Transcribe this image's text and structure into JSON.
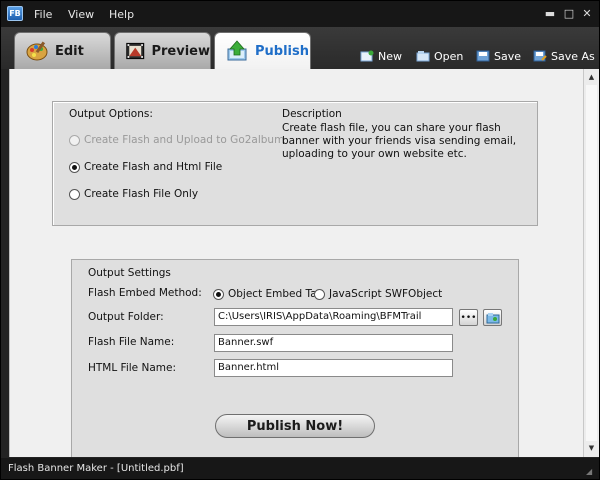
{
  "app": {
    "logo_text": "FB"
  },
  "menubar": {
    "items": [
      "File",
      "View",
      "Help"
    ]
  },
  "window_controls": {
    "minimize": "▬",
    "maximize": "□",
    "close": "✕"
  },
  "tabs": [
    {
      "label": "Edit",
      "icon": "palette-icon",
      "active": false
    },
    {
      "label": "Preview",
      "icon": "film-icon",
      "active": false
    },
    {
      "label": "Publish",
      "icon": "publish-arrow-icon",
      "active": true
    }
  ],
  "toolbar": {
    "new_label": "New",
    "open_label": "Open",
    "save_label": "Save",
    "saveas_label": "Save As"
  },
  "output_options": {
    "title": "Output Options:",
    "description_title": "Description",
    "description_text": "Create flash file, you can share your flash banner with your friends visa sending email, uploading to your own website etc.",
    "choices": [
      {
        "label": "Create Flash and Upload to Go2album",
        "checked": false,
        "disabled": true
      },
      {
        "label": "Create Flash and Html File",
        "checked": true,
        "disabled": false
      },
      {
        "label": "Create Flash File Only",
        "checked": false,
        "disabled": false
      }
    ]
  },
  "output_settings": {
    "title": "Output Settings",
    "embed_label": "Flash Embed Method:",
    "embed_option_1": "Object Embed Tag",
    "embed_option_2": "JavaScript SWFObject",
    "embed_selected": "Object Embed Tag",
    "folder_label": "Output Folder:",
    "folder_value": "C:\\Users\\IRIS\\AppData\\Roaming\\BFMTrail",
    "browse_label": "•••",
    "flash_name_label": "Flash File Name:",
    "flash_name_value": "Banner.swf",
    "html_name_label": "HTML File Name:",
    "html_name_value": "Banner.html",
    "publish_label": "Publish Now!"
  },
  "statusbar": {
    "text": "Flash Banner Maker - [Untitled.pbf]"
  },
  "colors": {
    "chrome": "#171717",
    "content": "#f0f0f0",
    "panel": "#dfdfdf",
    "active_tab_text": "#1f6ec8"
  }
}
